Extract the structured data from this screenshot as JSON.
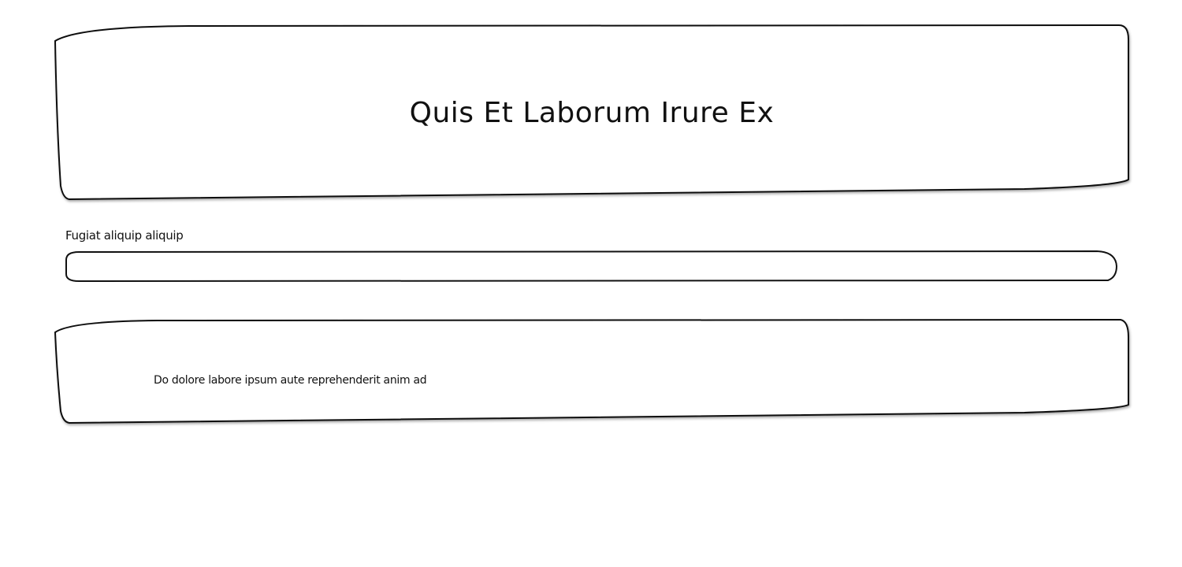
{
  "header": {
    "title": "Quis Et Laborum Irure Ex"
  },
  "form": {
    "field_label": "Fugiat aliquip aliquip",
    "field_value": "",
    "field_placeholder": ""
  },
  "card": {
    "text": "Do dolore labore ipsum aute reprehenderit anim ad"
  }
}
